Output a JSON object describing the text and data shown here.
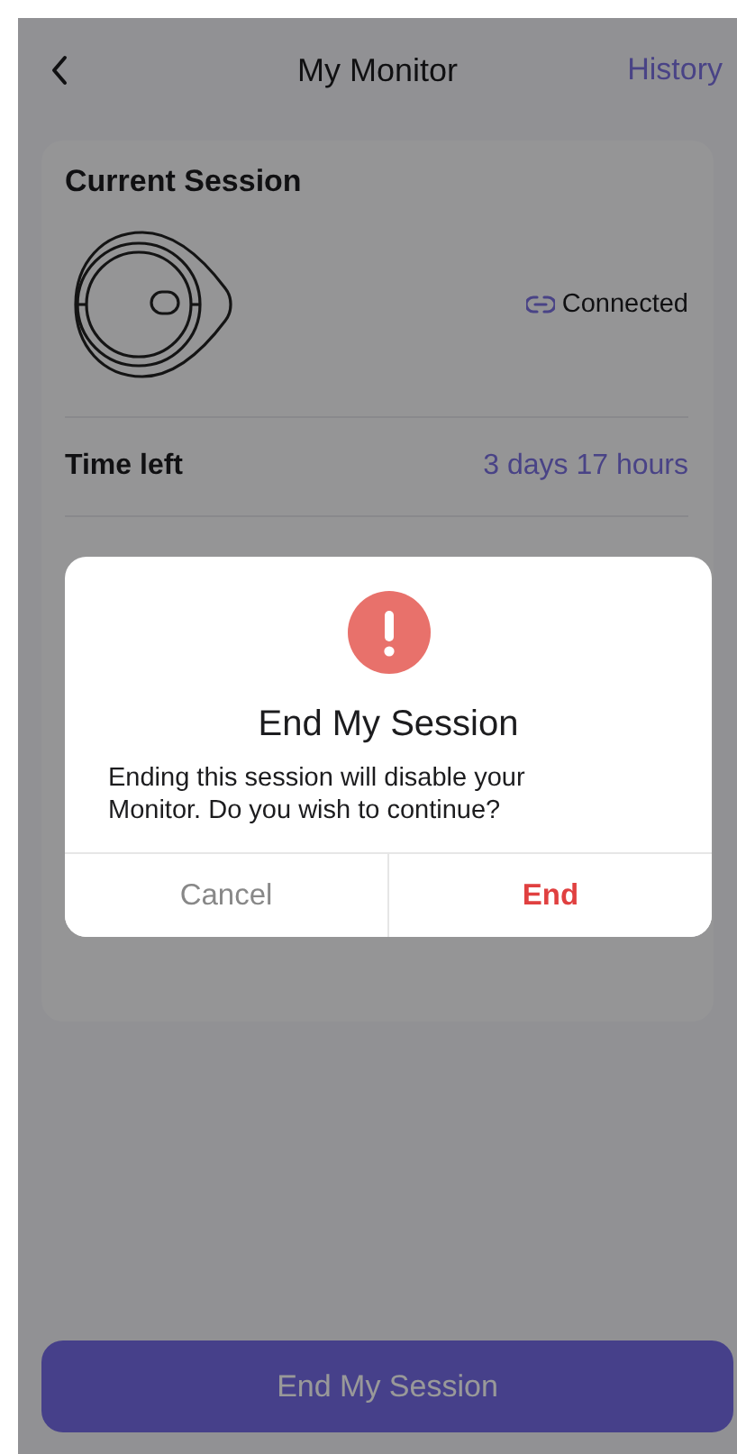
{
  "header": {
    "title": "My Monitor",
    "action": "History"
  },
  "session": {
    "title": "Current Session",
    "status": "Connected",
    "rows": [
      {
        "label": "Time left",
        "value": "3 days 17 hours",
        "kind": "highlight"
      }
    ]
  },
  "footer_button": "End My Session",
  "dialog": {
    "title": "End My Session",
    "message": "Ending this session will disable your Monitor. Do you wish to continue?",
    "buttons": [
      {
        "label": "Cancel",
        "kind": "cancel"
      },
      {
        "label": "End",
        "kind": "destructive"
      }
    ]
  }
}
